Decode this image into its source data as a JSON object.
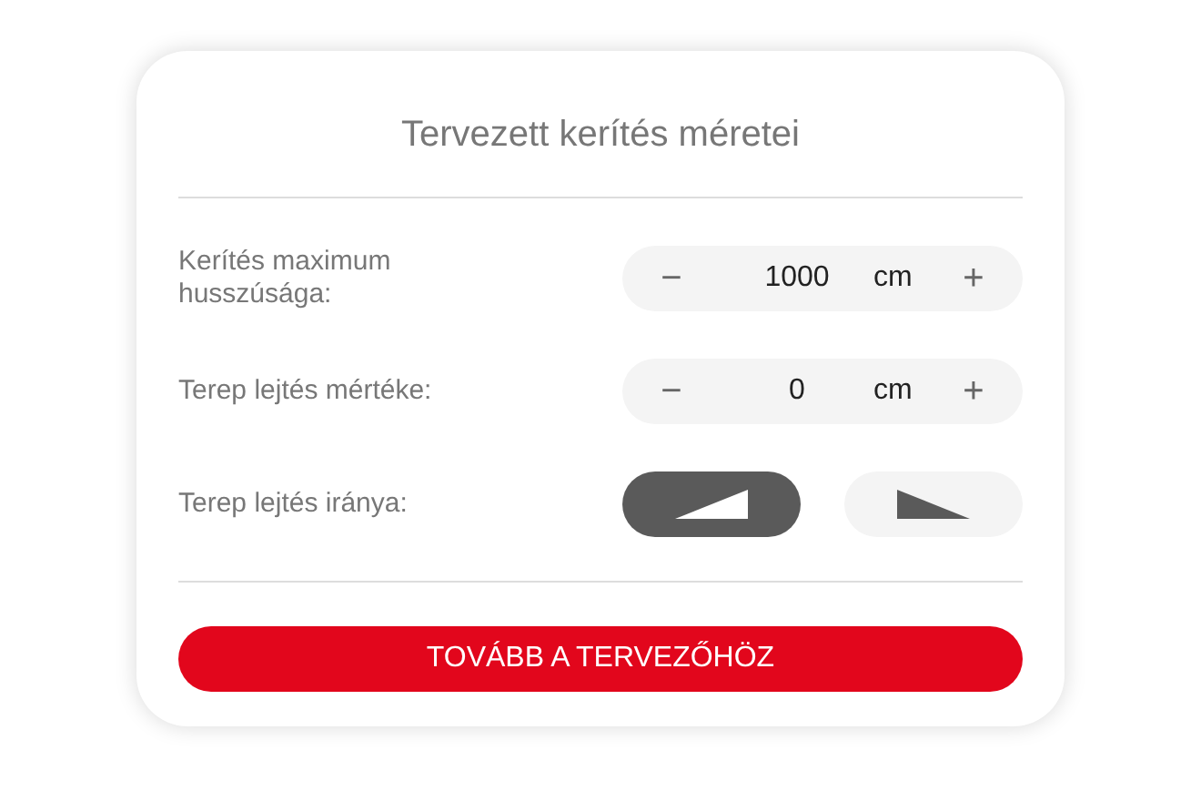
{
  "title": "Tervezett kerítés méretei",
  "steppers": [
    {
      "label": "Kerítés maximum husszúsága:",
      "minus": "−",
      "value": "1000",
      "unit": "cm",
      "plus": "+"
    },
    {
      "label": "Terep lejtés mértéke:",
      "minus": "−",
      "value": "0",
      "unit": "cm",
      "plus": "+"
    }
  ],
  "direction": {
    "label": "Terep lejtés iránya:",
    "options": [
      {
        "kind": "rising",
        "selected": true
      },
      {
        "kind": "falling",
        "selected": false
      }
    ]
  },
  "submit": "TOVÁBB A TERVEZŐHÖZ"
}
